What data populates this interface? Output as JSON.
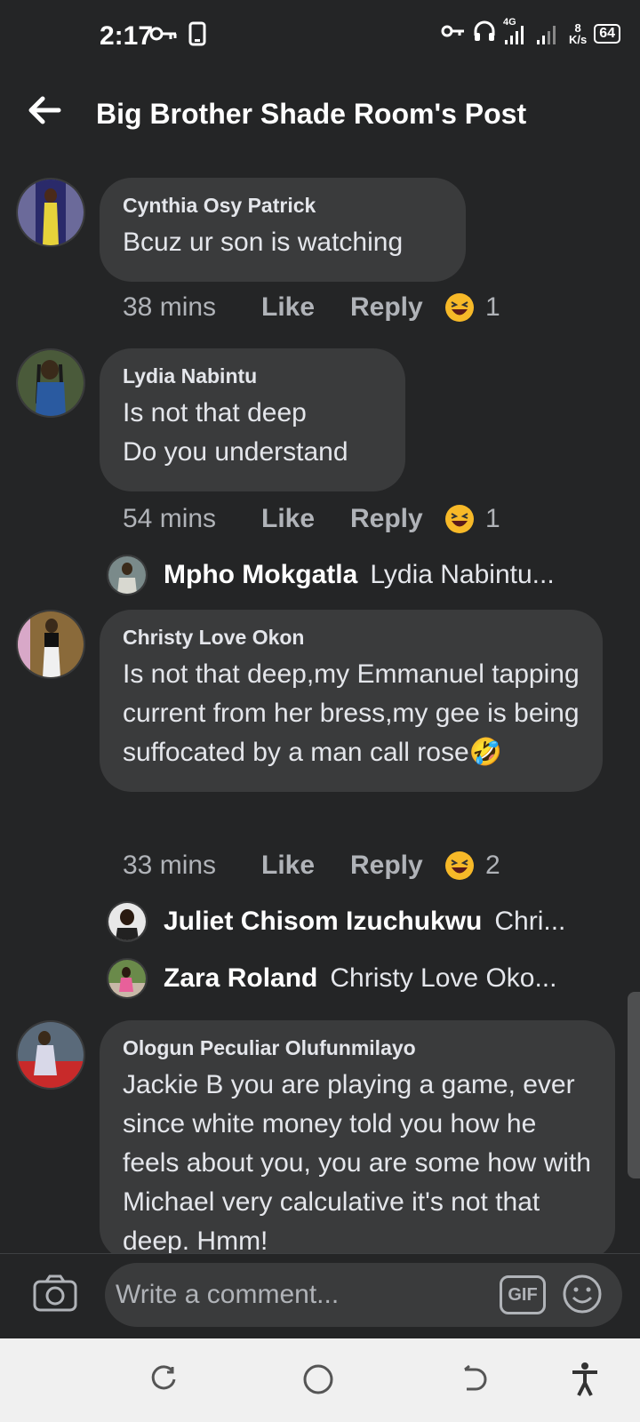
{
  "status_bar": {
    "time": "2:17",
    "speed_value": "8",
    "speed_unit": "K/s",
    "battery": "64",
    "network": "4G",
    "icons": [
      "key-icon",
      "phone-icon",
      "vpn-key-icon",
      "headphones-icon",
      "signal-icon",
      "battery-icon"
    ]
  },
  "header": {
    "title": "Big Brother Shade Room's Post",
    "back_icon": "arrow-left-icon"
  },
  "comments": [
    {
      "author": "Cynthia Osy Patrick",
      "text": "Bcuz ur son is watching",
      "time": "38 mins",
      "like_label": "Like",
      "reply_label": "Reply",
      "reaction": "laughing-emoji",
      "reaction_count": "1",
      "avatar_color": "#6b6a9a"
    },
    {
      "author": "Lydia Nabintu",
      "text": "Is not that deep\nDo you understand",
      "time": "54 mins",
      "like_label": "Like",
      "reply_label": "Reply",
      "reaction": "laughing-emoji",
      "reaction_count": "1",
      "avatar_color": "#4a5a3a",
      "replies": [
        {
          "name": "Mpho Mokgatla",
          "preview": "Lydia Nabintu..."
        }
      ]
    },
    {
      "author": "Christy Love Okon",
      "text": "Is not that deep,my Emmanuel tapping current from her bress,my gee is being suffocated by a man call rose🤣",
      "time": "33 mins",
      "like_label": "Like",
      "reply_label": "Reply",
      "reaction": "laughing-emoji",
      "reaction_count": "2",
      "avatar_color": "#8a6a3a",
      "replies": [
        {
          "name": "Juliet Chisom Izuchukwu",
          "preview": "Chri..."
        },
        {
          "name": "Zara Roland",
          "preview": "Christy Love Oko..."
        }
      ]
    },
    {
      "author": "Ologun Peculiar Olufunmilayo",
      "text": "Jackie B you are playing a game, ever since white money told you how he feels about you, you are some how with Michael very calculative it's not that deep. Hmm!",
      "avatar_color": "#9a3a2a"
    }
  ],
  "composer": {
    "placeholder": "Write a comment...",
    "gif_label": "GIF",
    "camera_icon": "camera-icon",
    "emoji_icon": "smiley-icon"
  },
  "nav": {
    "icons": [
      "rotate-icon",
      "home-circle-icon",
      "back-icon",
      "accessibility-icon"
    ]
  },
  "colors": {
    "background": "#242526",
    "bubble": "#3a3b3c",
    "text": "#e4e6eb",
    "secondary_text": "#b0b3b8",
    "navbar": "#f0f0f0"
  }
}
